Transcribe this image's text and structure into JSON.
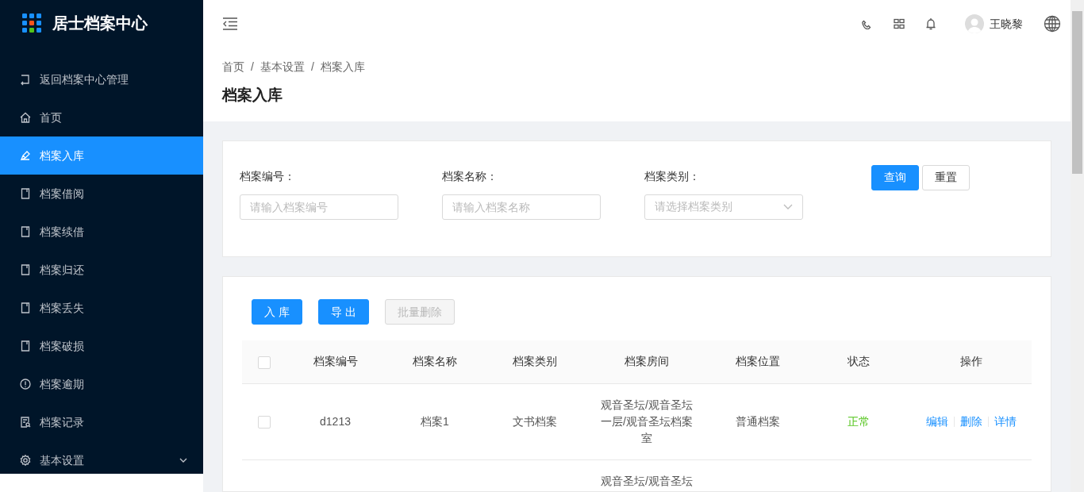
{
  "app": {
    "title": "居士档案中心"
  },
  "sidebar": {
    "items": [
      {
        "label": "返回档案中心管理",
        "selected": false
      },
      {
        "label": "首页",
        "selected": false
      },
      {
        "label": "档案入库",
        "selected": true
      },
      {
        "label": "档案借阅",
        "selected": false
      },
      {
        "label": "档案续借",
        "selected": false
      },
      {
        "label": "档案归还",
        "selected": false
      },
      {
        "label": "档案丢失",
        "selected": false
      },
      {
        "label": "档案破损",
        "selected": false
      },
      {
        "label": "档案逾期",
        "selected": false
      },
      {
        "label": "档案记录",
        "selected": false
      },
      {
        "label": "基本设置",
        "selected": false,
        "expanded": false
      }
    ]
  },
  "header": {
    "user_name": "王晓黎"
  },
  "breadcrumb": [
    "首页",
    "基本设置",
    "档案入库"
  ],
  "breadcrumb_separator": "/",
  "page_title": "档案入库",
  "filters": [
    {
      "kind": "input",
      "label": "档案编号：",
      "placeholder": "请输入档案编号"
    },
    {
      "kind": "input",
      "label": "档案名称：",
      "placeholder": "请输入档案名称"
    },
    {
      "kind": "select",
      "label": "档案类别：",
      "placeholder": "请选择档案类别"
    }
  ],
  "filter_buttons": [
    {
      "kind": "primary",
      "label": "查询"
    },
    {
      "kind": "default",
      "label": "重置"
    }
  ],
  "toolbar": [
    {
      "label": "入 库",
      "disabled": false
    },
    {
      "label": "导 出",
      "disabled": false
    },
    {
      "label": "批量删除",
      "disabled": true
    }
  ],
  "table": {
    "header_checked": false,
    "columns": [
      "档案编号",
      "档案名称",
      "档案类别",
      "档案房间",
      "档案位置",
      "状态",
      "操作"
    ],
    "rows": [
      {
        "checked": false,
        "number": "d1213",
        "name": "档案1",
        "category": "文书档案",
        "room": "观音圣坛/观音圣坛一层/观音圣坛档案室",
        "location": "普通档案",
        "status": {
          "text": "正常",
          "kind": "normal"
        },
        "actions": [
          "编辑",
          "删除",
          "详情"
        ]
      },
      {
        "room": "观音圣坛/观音圣坛"
      }
    ]
  }
}
